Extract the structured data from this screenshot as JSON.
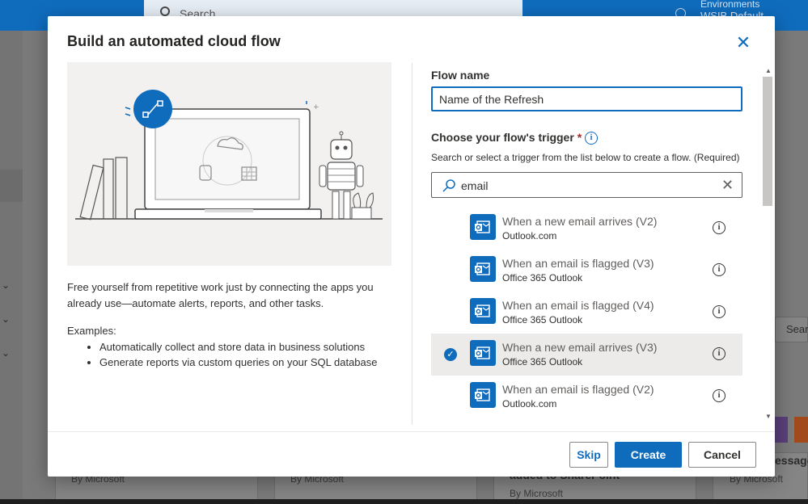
{
  "background": {
    "search_placeholder": "Search",
    "env_label": "Environments",
    "env_name": "WSIB Default",
    "card_by": [
      "By Microsoft",
      "By Microsoft",
      "By Microsoft",
      "By Microsoft"
    ],
    "right_search": "Sear",
    "messages_text": "essage",
    "sharepoint_text": "added to SharePoint"
  },
  "dialog": {
    "title": "Build an automated cloud flow",
    "intro": "Free yourself from repetitive work just by connecting the apps you already use—automate alerts, reports, and other tasks.",
    "examples_title": "Examples:",
    "examples": [
      "Automatically collect and store data in business solutions",
      "Generate reports via custom queries on your SQL database"
    ],
    "flow_name_label": "Flow name",
    "flow_name_value": "Name of the Refresh",
    "trigger_label": "Choose your flow's trigger",
    "required_mark": "*",
    "trigger_hint": "Search or select a trigger from the list below to create a flow. (Required)",
    "trigger_search_value": "email",
    "triggers": [
      {
        "title": "When a new email arrives (V2)",
        "connector": "Outlook.com",
        "selected": false
      },
      {
        "title": "When an email is flagged (V3)",
        "connector": "Office 365 Outlook",
        "selected": false
      },
      {
        "title": "When an email is flagged (V4)",
        "connector": "Office 365 Outlook",
        "selected": false
      },
      {
        "title": "When a new email arrives (V3)",
        "connector": "Office 365 Outlook",
        "selected": true
      },
      {
        "title": "When an email is flagged (V2)",
        "connector": "Outlook.com",
        "selected": false
      }
    ],
    "buttons": {
      "skip": "Skip",
      "create": "Create",
      "cancel": "Cancel"
    },
    "colors": {
      "accent": "#0f6cbd",
      "selected_row": "#edebe9"
    }
  }
}
